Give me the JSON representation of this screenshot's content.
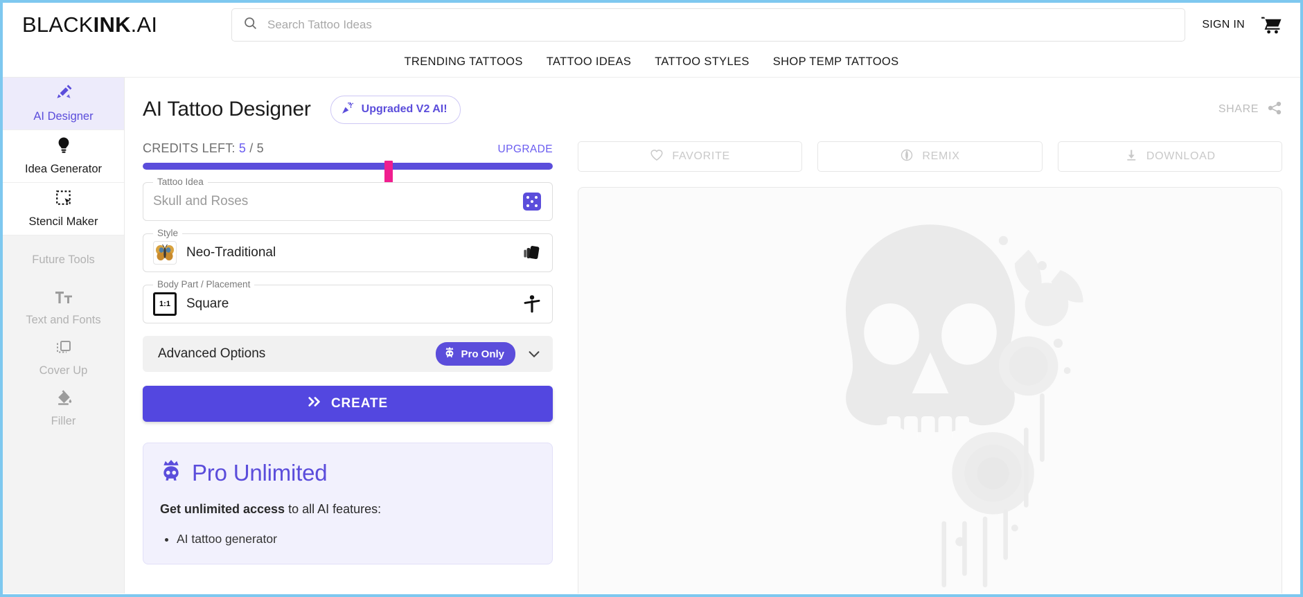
{
  "header": {
    "logo_light_1": "BLACK",
    "logo_bold": "INK",
    "logo_light_2": ".AI",
    "search_placeholder": "Search Tattoo Ideas",
    "search_value": "",
    "sign_in": "SIGN IN",
    "cart_icon": "shopping-cart-icon",
    "search_icon": "search-icon"
  },
  "nav": {
    "items": [
      {
        "label": "TRENDING TATTOOS"
      },
      {
        "label": "TATTOO IDEAS"
      },
      {
        "label": "TATTOO STYLES"
      },
      {
        "label": "SHOP TEMP TATTOOS"
      }
    ]
  },
  "sidebar": {
    "items": [
      {
        "label": "AI Designer",
        "icon": "pen-tools-icon",
        "active": true
      },
      {
        "label": "Idea Generator",
        "icon": "lightbulb-icon",
        "active": false
      },
      {
        "label": "Stencil Maker",
        "icon": "selection-cursor-icon",
        "active": false
      }
    ],
    "future_title": "Future Tools",
    "future_items": [
      {
        "label": "Text and Fonts",
        "icon": "text-format-icon"
      },
      {
        "label": "Cover Up",
        "icon": "layers-square-icon"
      },
      {
        "label": "Filler",
        "icon": "paint-bucket-icon"
      }
    ]
  },
  "main": {
    "page_title": "AI Tattoo Designer",
    "upgraded_badge": "Upgraded V2 AI!",
    "upgraded_badge_icon": "party-popper-icon",
    "credits_prefix": "CREDITS LEFT:",
    "credits_current": "5",
    "credits_separator": "/",
    "credits_total": "5",
    "upgrade_link": "UPGRADE",
    "progress_percent": 100,
    "cursor_percent": 60,
    "accent_color": "#5b4ddb",
    "cursor_color": "#f01e8f",
    "fields": {
      "tattoo_idea": {
        "legend": "Tattoo Idea",
        "placeholder": "Skull and Roses",
        "value": "",
        "action_icon": "dice-randomize-icon"
      },
      "style": {
        "legend": "Style",
        "value": "Neo-Traditional",
        "thumb_icon": "butterfly-thumbnail-icon",
        "action_icon": "style-cards-icon"
      },
      "body_part": {
        "legend": "Body Part / Placement",
        "value": "Square",
        "thumb_label": "1:1",
        "action_icon": "body-figure-icon"
      }
    },
    "advanced": {
      "label": "Advanced Options",
      "pill_label": "Pro Only",
      "pill_icon": "crown-skull-icon",
      "chevron_icon": "chevron-down-icon"
    },
    "create_button": {
      "label": "CREATE",
      "icon": "double-chevron-right-icon"
    },
    "pro_card": {
      "icon": "crown-skull-icon",
      "title": "Pro Unlimited",
      "subtitle_bold": "Get unlimited access",
      "subtitle_rest": " to all AI features:",
      "features": [
        "AI tattoo generator"
      ]
    }
  },
  "right_panel": {
    "share_label": "SHARE",
    "share_icon": "share-nodes-icon",
    "actions": [
      {
        "label": "FAVORITE",
        "icon": "heart-icon"
      },
      {
        "label": "REMIX",
        "icon": "remix-icon"
      },
      {
        "label": "DOWNLOAD",
        "icon": "download-icon"
      }
    ],
    "preview": {
      "alt": "skull-and-roses-tattoo-watermark"
    }
  }
}
